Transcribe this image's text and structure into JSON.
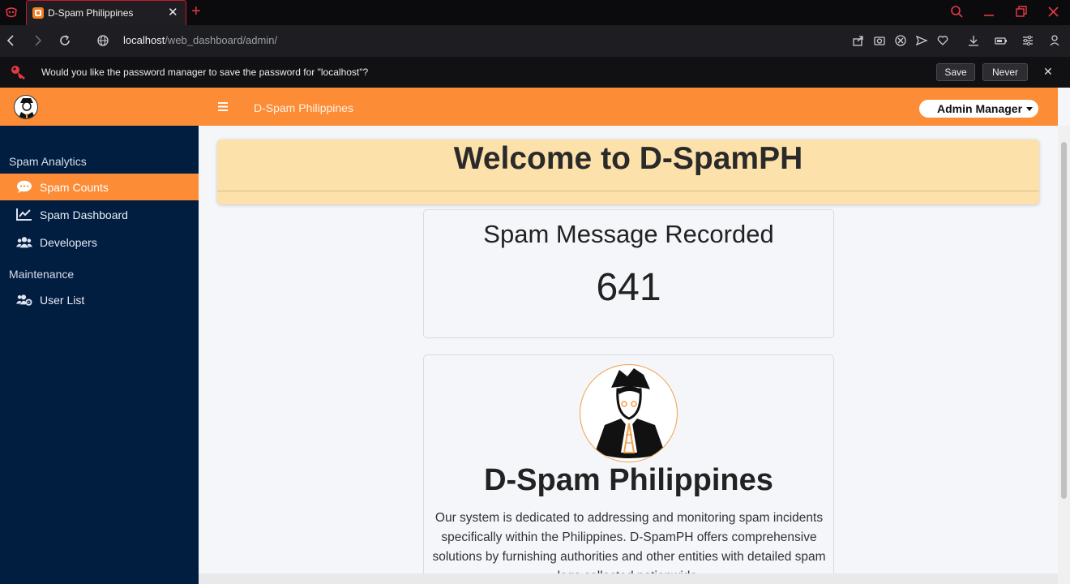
{
  "browser": {
    "tab_title": "D-Spam Philippines",
    "address_host": "localhost",
    "address_path": "/web_dashboard/admin/",
    "password_prompt": "Would you like the password manager to save the password for \"localhost\"?",
    "save_label": "Save",
    "never_label": "Never"
  },
  "topbar": {
    "title": "D-Spam Philippines",
    "user_menu": "Admin Manager"
  },
  "sidebar": {
    "sections": [
      {
        "header": "Spam Analytics",
        "items": [
          {
            "label": "Spam Counts",
            "icon": "sms-bubble-icon",
            "active": true
          },
          {
            "label": "Spam Dashboard",
            "icon": "chart-line-icon",
            "active": false
          },
          {
            "label": "Developers",
            "icon": "users-icon",
            "active": false
          }
        ]
      },
      {
        "header": "Maintenance",
        "items": [
          {
            "label": "User List",
            "icon": "users-cog-icon",
            "active": false
          }
        ]
      }
    ]
  },
  "main": {
    "welcome": "Welcome to D-SpamPH",
    "stat_title": "Spam Message Recorded",
    "stat_value": "641",
    "about_title": "D-Spam Philippines",
    "about_text": "Our system is dedicated to addressing and monitoring spam incidents specifically within the Philippines. D-SpamPH offers comprehensive solutions by furnishing authorities and other entities with detailed spam logs collected nationwide."
  },
  "colors": {
    "accent": "#fd8c36",
    "sidebar_bg": "#011d40",
    "welcome_bg": "#fde1ab"
  }
}
